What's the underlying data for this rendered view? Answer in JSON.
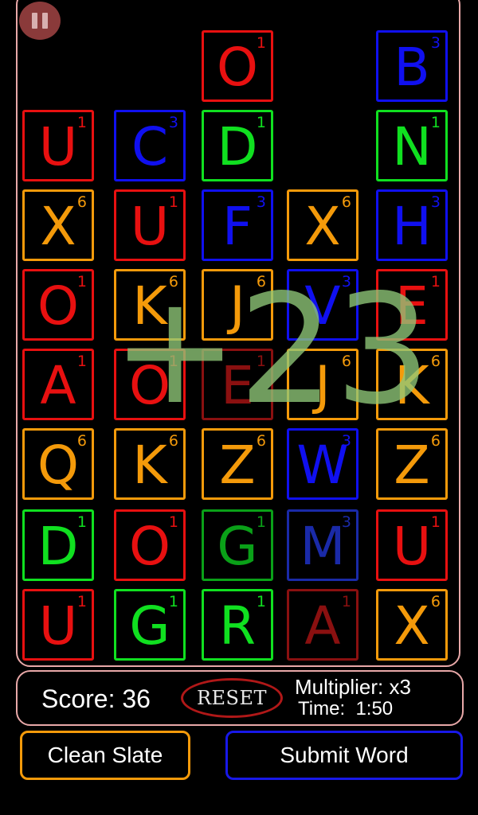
{
  "game": {
    "floating_score": "+23",
    "pause_icon": "pause-icon"
  },
  "colors": {
    "red": "#e81010",
    "blue": "#1010f0",
    "green": "#10e020",
    "orange": "#f49a0a",
    "dim_red": "#8a1010",
    "dim_green": "#0aa018",
    "dim_blue": "#1a2aa8",
    "border": "#e8a8a8"
  },
  "columns": [
    [
      {
        "letter": "U",
        "points": "1",
        "color": "red"
      },
      {
        "letter": "X",
        "points": "6",
        "color": "orange"
      },
      {
        "letter": "O",
        "points": "1",
        "color": "red"
      },
      {
        "letter": "A",
        "points": "1",
        "color": "red"
      },
      {
        "letter": "Q",
        "points": "6",
        "color": "orange"
      },
      {
        "letter": "D",
        "points": "1",
        "color": "green"
      },
      {
        "letter": "U",
        "points": "1",
        "color": "red"
      }
    ],
    [
      {
        "letter": "C",
        "points": "3",
        "color": "blue"
      },
      {
        "letter": "U",
        "points": "1",
        "color": "red"
      },
      {
        "letter": "K",
        "points": "6",
        "color": "orange"
      },
      {
        "letter": "O",
        "points": "1",
        "color": "red"
      },
      {
        "letter": "K",
        "points": "6",
        "color": "orange"
      },
      {
        "letter": "O",
        "points": "1",
        "color": "red"
      },
      {
        "letter": "G",
        "points": "1",
        "color": "green"
      }
    ],
    [
      {
        "letter": "O",
        "points": "1",
        "color": "red"
      },
      {
        "letter": "D",
        "points": "1",
        "color": "green"
      },
      {
        "letter": "F",
        "points": "3",
        "color": "blue"
      },
      {
        "letter": "J",
        "points": "6",
        "color": "orange"
      },
      {
        "letter": "E",
        "points": "1",
        "color": "red",
        "selected": true
      },
      {
        "letter": "Z",
        "points": "6",
        "color": "orange"
      },
      {
        "letter": "G",
        "points": "1",
        "color": "green",
        "selected": true
      },
      {
        "letter": "R",
        "points": "1",
        "color": "green"
      }
    ],
    [
      {
        "letter": "X",
        "points": "6",
        "color": "orange"
      },
      {
        "letter": "V",
        "points": "3",
        "color": "blue"
      },
      {
        "letter": "J",
        "points": "6",
        "color": "orange"
      },
      {
        "letter": "W",
        "points": "3",
        "color": "blue"
      },
      {
        "letter": "M",
        "points": "3",
        "color": "blue",
        "selected": true
      },
      {
        "letter": "A",
        "points": "1",
        "color": "red",
        "selected": true
      }
    ],
    [
      {
        "letter": "B",
        "points": "3",
        "color": "blue"
      },
      {
        "letter": "N",
        "points": "1",
        "color": "green"
      },
      {
        "letter": "H",
        "points": "3",
        "color": "blue"
      },
      {
        "letter": "E",
        "points": "1",
        "color": "red"
      },
      {
        "letter": "K",
        "points": "6",
        "color": "orange"
      },
      {
        "letter": "Z",
        "points": "6",
        "color": "orange"
      },
      {
        "letter": "U",
        "points": "1",
        "color": "red"
      },
      {
        "letter": "X",
        "points": "6",
        "color": "orange"
      }
    ]
  ],
  "status": {
    "score_text": "Score: 36",
    "reset_label": "RESET",
    "multiplier_text": "Multiplier: x3",
    "time_text": "Time:  1:50"
  },
  "buttons": {
    "clean_slate": "Clean Slate",
    "submit_word": "Submit Word"
  }
}
